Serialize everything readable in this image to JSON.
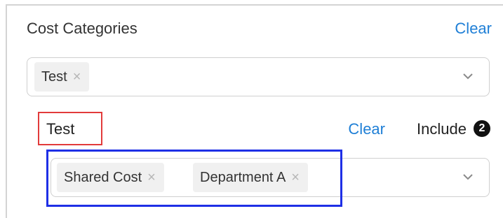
{
  "cost_categories": {
    "title": "Cost Categories",
    "clear_label": "Clear",
    "selected_tags": [
      {
        "label": "Test",
        "remove_glyph": "×"
      }
    ],
    "dropdown_icon": "chevron-down-icon"
  },
  "category_filter": {
    "name": "Test",
    "clear_label": "Clear",
    "mode_label": "Include",
    "count": "2",
    "selected_values": [
      {
        "label": "Shared Cost",
        "remove_glyph": "×"
      },
      {
        "label": "Department A",
        "remove_glyph": "×"
      }
    ],
    "dropdown_icon": "chevron-down-icon"
  },
  "colors": {
    "link": "#1f7fd6",
    "tag_bg": "#f0f0f0",
    "highlight_red": "#e23b3b",
    "highlight_blue": "#1e2fe6"
  }
}
